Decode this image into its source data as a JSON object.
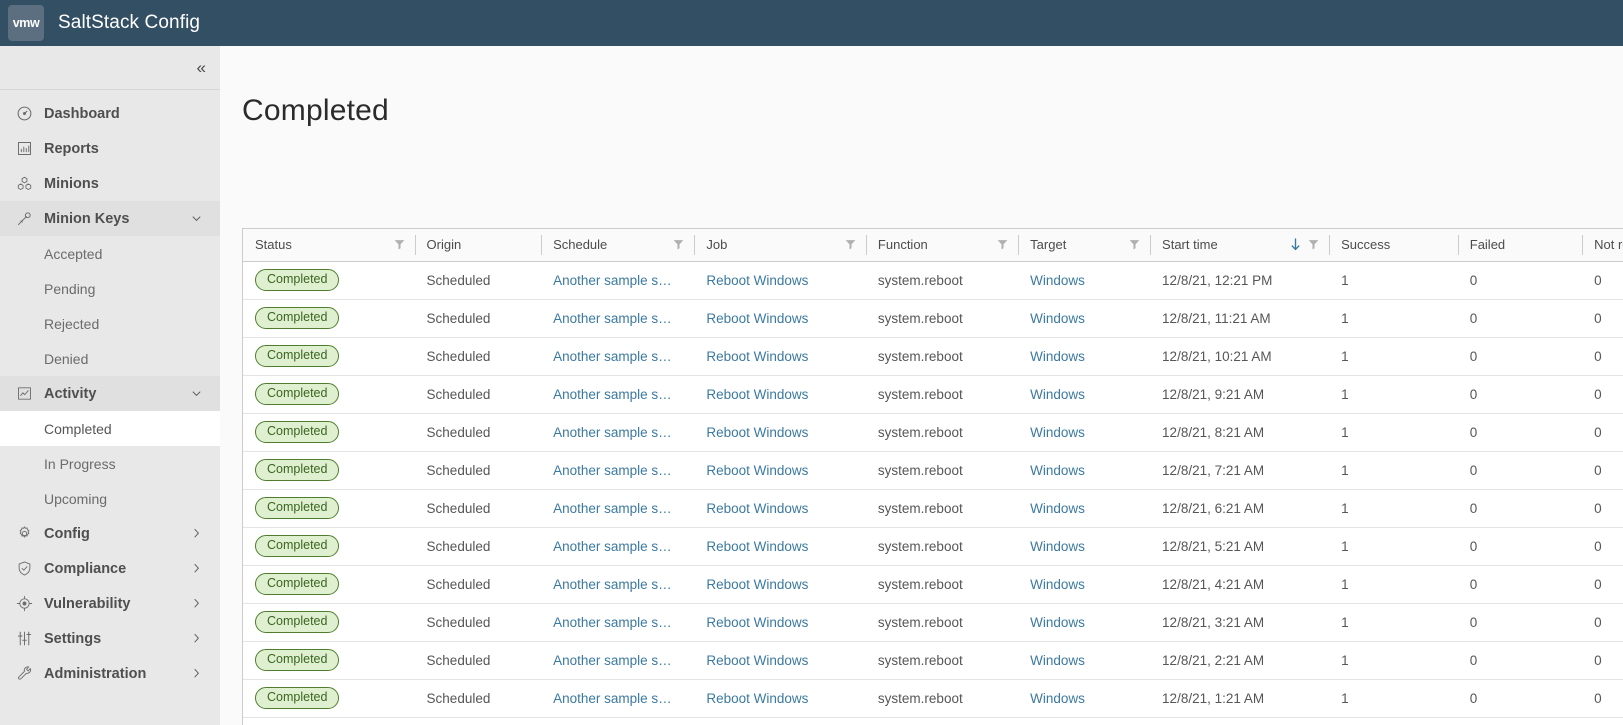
{
  "topbar": {
    "logo_text": "vmw",
    "app_title": "SaltStack Config"
  },
  "sidebar": {
    "collapse_glyph": "«",
    "items": [
      {
        "label": "Dashboard",
        "icon": "dashboard-gauge-icon",
        "type": "item"
      },
      {
        "label": "Reports",
        "icon": "bar-chart-icon",
        "type": "item"
      },
      {
        "label": "Minions",
        "icon": "minions-cluster-icon",
        "type": "item"
      },
      {
        "label": "Minion Keys",
        "icon": "key-icon",
        "type": "group",
        "expanded": true,
        "caret": "chevron-down-icon"
      },
      {
        "label": "Accepted",
        "type": "sub"
      },
      {
        "label": "Pending",
        "type": "sub"
      },
      {
        "label": "Rejected",
        "type": "sub"
      },
      {
        "label": "Denied",
        "type": "sub"
      },
      {
        "label": "Activity",
        "icon": "activity-graph-icon",
        "type": "group",
        "expanded": true,
        "caret": "chevron-down-icon"
      },
      {
        "label": "Completed",
        "type": "sub",
        "active": true
      },
      {
        "label": "In Progress",
        "type": "sub"
      },
      {
        "label": "Upcoming",
        "type": "sub"
      },
      {
        "label": "Config",
        "icon": "gear-icon",
        "type": "group",
        "expanded": false,
        "caret": "chevron-right-icon"
      },
      {
        "label": "Compliance",
        "icon": "shield-check-icon",
        "type": "group",
        "expanded": false,
        "caret": "chevron-right-icon"
      },
      {
        "label": "Vulnerability",
        "icon": "target-crosshair-icon",
        "type": "group",
        "expanded": false,
        "caret": "chevron-right-icon"
      },
      {
        "label": "Settings",
        "icon": "sliders-icon",
        "type": "group",
        "expanded": false,
        "caret": "chevron-right-icon"
      },
      {
        "label": "Administration",
        "icon": "wrench-icon",
        "type": "group",
        "expanded": false,
        "caret": "chevron-right-icon"
      }
    ]
  },
  "main": {
    "page_title": "Completed"
  },
  "table": {
    "columns": [
      {
        "key": "status",
        "label": "Status",
        "filter": true,
        "sort": null,
        "class": "c-status"
      },
      {
        "key": "origin",
        "label": "Origin",
        "filter": false,
        "sort": null,
        "class": "c-origin"
      },
      {
        "key": "schedule",
        "label": "Schedule",
        "filter": true,
        "sort": null,
        "class": "c-sched"
      },
      {
        "key": "job",
        "label": "Job",
        "filter": true,
        "sort": null,
        "class": "c-job"
      },
      {
        "key": "function",
        "label": "Function",
        "filter": true,
        "sort": null,
        "class": "c-func"
      },
      {
        "key": "target",
        "label": "Target",
        "filter": true,
        "sort": null,
        "class": "c-target"
      },
      {
        "key": "start_time",
        "label": "Start time",
        "filter": true,
        "sort": "desc",
        "class": "c-start"
      },
      {
        "key": "success",
        "label": "Success",
        "filter": false,
        "sort": null,
        "class": "c-success"
      },
      {
        "key": "failed",
        "label": "Failed",
        "filter": false,
        "sort": null,
        "class": "c-failed"
      },
      {
        "key": "not_returned",
        "label": "Not returned",
        "filter": false,
        "sort": null,
        "class": "c-nret"
      }
    ],
    "rows": [
      {
        "status": "Completed",
        "origin": "Scheduled",
        "schedule": "Another sample s…",
        "job": "Reboot Windows",
        "function": "system.reboot",
        "target": "Windows",
        "start_time": "12/8/21, 12:21 PM",
        "success": "1",
        "failed": "0",
        "not_returned": "0"
      },
      {
        "status": "Completed",
        "origin": "Scheduled",
        "schedule": "Another sample s…",
        "job": "Reboot Windows",
        "function": "system.reboot",
        "target": "Windows",
        "start_time": "12/8/21, 11:21 AM",
        "success": "1",
        "failed": "0",
        "not_returned": "0"
      },
      {
        "status": "Completed",
        "origin": "Scheduled",
        "schedule": "Another sample s…",
        "job": "Reboot Windows",
        "function": "system.reboot",
        "target": "Windows",
        "start_time": "12/8/21, 10:21 AM",
        "success": "1",
        "failed": "0",
        "not_returned": "0"
      },
      {
        "status": "Completed",
        "origin": "Scheduled",
        "schedule": "Another sample s…",
        "job": "Reboot Windows",
        "function": "system.reboot",
        "target": "Windows",
        "start_time": "12/8/21, 9:21 AM",
        "success": "1",
        "failed": "0",
        "not_returned": "0"
      },
      {
        "status": "Completed",
        "origin": "Scheduled",
        "schedule": "Another sample s…",
        "job": "Reboot Windows",
        "function": "system.reboot",
        "target": "Windows",
        "start_time": "12/8/21, 8:21 AM",
        "success": "1",
        "failed": "0",
        "not_returned": "0"
      },
      {
        "status": "Completed",
        "origin": "Scheduled",
        "schedule": "Another sample s…",
        "job": "Reboot Windows",
        "function": "system.reboot",
        "target": "Windows",
        "start_time": "12/8/21, 7:21 AM",
        "success": "1",
        "failed": "0",
        "not_returned": "0"
      },
      {
        "status": "Completed",
        "origin": "Scheduled",
        "schedule": "Another sample s…",
        "job": "Reboot Windows",
        "function": "system.reboot",
        "target": "Windows",
        "start_time": "12/8/21, 6:21 AM",
        "success": "1",
        "failed": "0",
        "not_returned": "0"
      },
      {
        "status": "Completed",
        "origin": "Scheduled",
        "schedule": "Another sample s…",
        "job": "Reboot Windows",
        "function": "system.reboot",
        "target": "Windows",
        "start_time": "12/8/21, 5:21 AM",
        "success": "1",
        "failed": "0",
        "not_returned": "0"
      },
      {
        "status": "Completed",
        "origin": "Scheduled",
        "schedule": "Another sample s…",
        "job": "Reboot Windows",
        "function": "system.reboot",
        "target": "Windows",
        "start_time": "12/8/21, 4:21 AM",
        "success": "1",
        "failed": "0",
        "not_returned": "0"
      },
      {
        "status": "Completed",
        "origin": "Scheduled",
        "schedule": "Another sample s…",
        "job": "Reboot Windows",
        "function": "system.reboot",
        "target": "Windows",
        "start_time": "12/8/21, 3:21 AM",
        "success": "1",
        "failed": "0",
        "not_returned": "0"
      },
      {
        "status": "Completed",
        "origin": "Scheduled",
        "schedule": "Another sample s…",
        "job": "Reboot Windows",
        "function": "system.reboot",
        "target": "Windows",
        "start_time": "12/8/21, 2:21 AM",
        "success": "1",
        "failed": "0",
        "not_returned": "0"
      },
      {
        "status": "Completed",
        "origin": "Scheduled",
        "schedule": "Another sample s…",
        "job": "Reboot Windows",
        "function": "system.reboot",
        "target": "Windows",
        "start_time": "12/8/21, 1:21 AM",
        "success": "1",
        "failed": "0",
        "not_returned": "0"
      }
    ]
  },
  "colors": {
    "topbar_bg": "#324f63",
    "sidebar_bg": "#e8e8e8",
    "link": "#3b7aa0",
    "badge_bg": "#dff0d0",
    "badge_border": "#4e7e2d",
    "badge_text": "#3c6420",
    "sort_arrow": "#3b7aa0"
  }
}
